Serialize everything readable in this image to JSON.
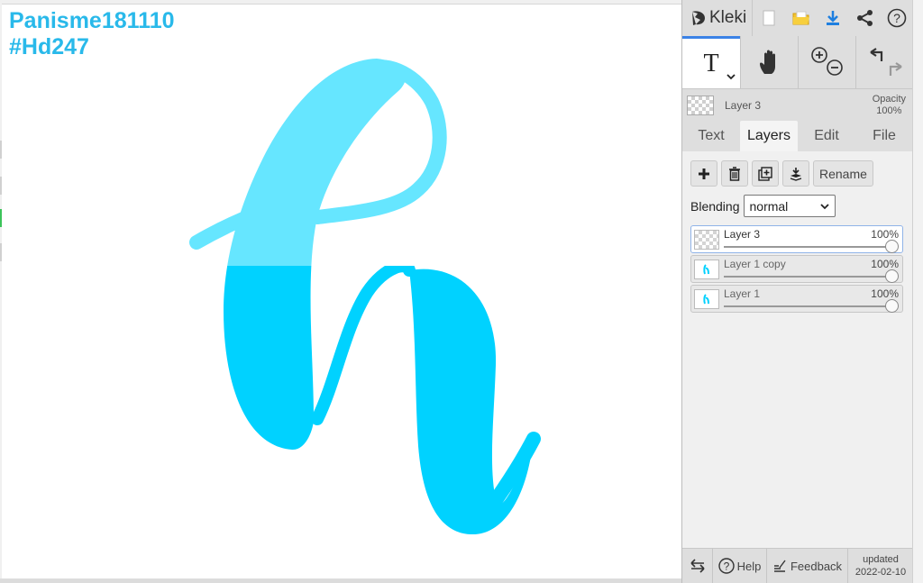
{
  "canvas": {
    "watermark_line1": "Panisme181110",
    "watermark_line2": "#Hd247",
    "colors": {
      "letter_light": "#66e6ff",
      "letter_dark": "#00d2ff",
      "watermark": "#29b9ea"
    }
  },
  "topbar": {
    "brand": "Kleki",
    "icons": [
      "new-image-icon",
      "open-folder-icon",
      "download-icon",
      "share-icon",
      "help-icon"
    ]
  },
  "tools": {
    "text_tool_glyph": "T",
    "icons": [
      "text-tool-icon",
      "hand-tool-icon",
      "zoom-in-icon",
      "zoom-out-icon",
      "undo-icon",
      "redo-icon"
    ]
  },
  "current_layer": {
    "name": "Layer 3",
    "opacity_label": "Opacity",
    "opacity_value": "100%"
  },
  "tabs": [
    {
      "label": "Text"
    },
    {
      "label": "Layers",
      "active": true
    },
    {
      "label": "Edit"
    },
    {
      "label": "File"
    }
  ],
  "layers_panel": {
    "rename_label": "Rename",
    "blending_label": "Blending",
    "blending_value": "normal",
    "layers": [
      {
        "name": "Layer 3",
        "opacity": "100%",
        "active": true
      },
      {
        "name": "Layer 1 copy",
        "opacity": "100%",
        "active": false
      },
      {
        "name": "Layer 1",
        "opacity": "100%",
        "active": false
      }
    ]
  },
  "bottombar": {
    "help_label": "Help",
    "feedback_label": "Feedback",
    "updated_label": "updated",
    "updated_date": "2022-02-10"
  }
}
